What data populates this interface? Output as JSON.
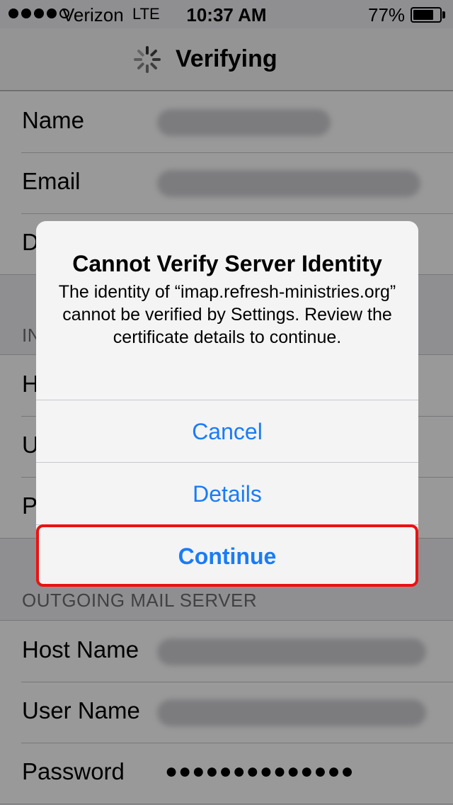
{
  "status_bar": {
    "carrier": "Verizon",
    "network": "LTE",
    "time": "10:37 AM",
    "battery": "77%",
    "battery_level": 0.77
  },
  "nav": {
    "title": "Verifying",
    "spinner_icon": "activity-spinner-icon"
  },
  "account_group": {
    "rows": [
      {
        "label": "Name"
      },
      {
        "label": "Email"
      },
      {
        "label": "D"
      }
    ]
  },
  "incoming": {
    "header": "IN",
    "rows": [
      {
        "label": "H"
      },
      {
        "label": "U"
      },
      {
        "label": "P"
      }
    ]
  },
  "outgoing": {
    "header": "OUTGOING MAIL SERVER",
    "rows": [
      {
        "label": "Host Name"
      },
      {
        "label": "User Name"
      },
      {
        "label": "Password",
        "value": "●●●●●●●●●●●●●●"
      }
    ]
  },
  "alert": {
    "title": "Cannot Verify Server Identity",
    "message": "The identity of “imap.refresh-ministries.org” cannot be verified by Settings. Review the certificate details to continue.",
    "buttons": {
      "cancel": "Cancel",
      "details": "Details",
      "continue": "Continue"
    },
    "accent_color": "#1a7cf5",
    "highlight_color": "#ee1111"
  }
}
